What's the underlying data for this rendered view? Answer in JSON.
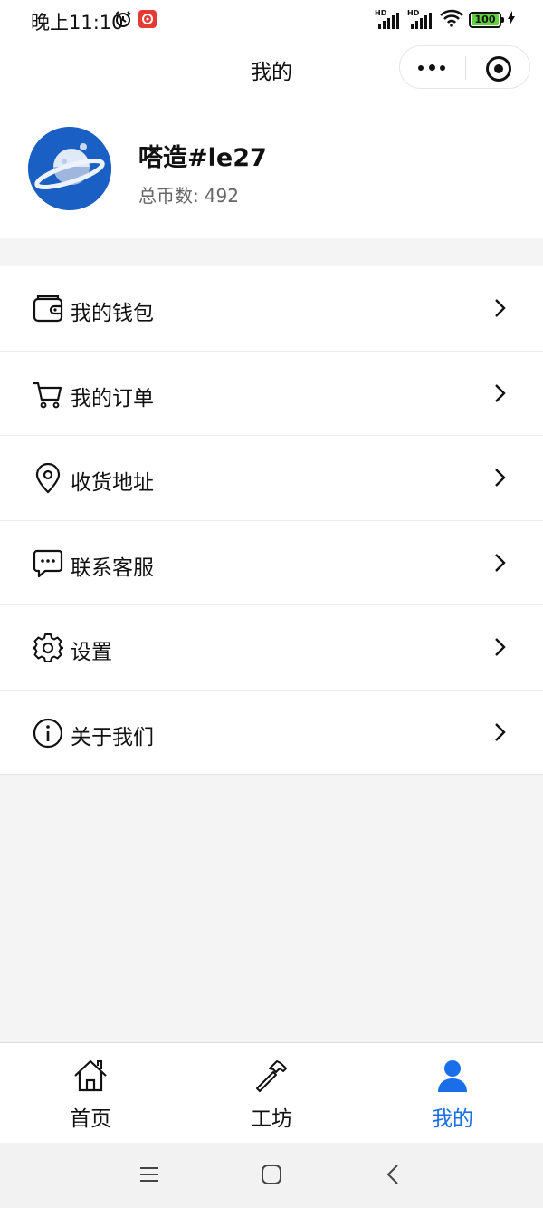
{
  "status_bar": {
    "time": "晚上11:10",
    "battery": "100",
    "signal1_label": "HD",
    "signal2_label": "HD",
    "battery_color": "#5fd13a"
  },
  "nav": {
    "title": "我的"
  },
  "profile": {
    "name": "嗒造#le27",
    "coins_label": "总币数:",
    "coins_value": "492"
  },
  "menu": {
    "items": [
      {
        "label": "我的钱包",
        "icon": "wallet-icon"
      },
      {
        "label": "我的订单",
        "icon": "cart-icon"
      },
      {
        "label": "收货地址",
        "icon": "location-pin-icon"
      },
      {
        "label": "联系客服",
        "icon": "chat-bubble-icon"
      },
      {
        "label": "设置",
        "icon": "gear-icon"
      },
      {
        "label": "关于我们",
        "icon": "info-icon"
      }
    ]
  },
  "tab_bar": {
    "tabs": [
      {
        "label": "首页",
        "icon": "home-icon"
      },
      {
        "label": "工坊",
        "icon": "hammer-icon"
      },
      {
        "label": "我的",
        "icon": "person-icon",
        "active": true
      }
    ],
    "active_color": "#1a6fe8"
  }
}
